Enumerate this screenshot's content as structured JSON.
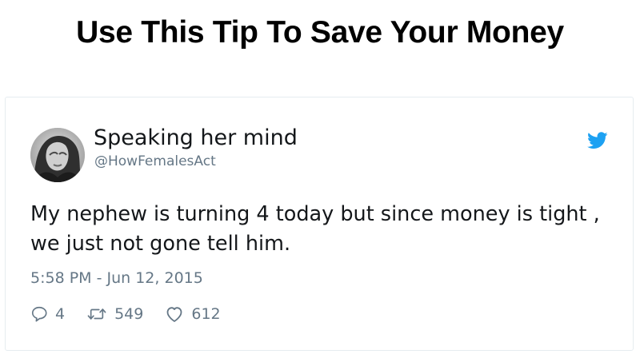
{
  "headline": "Use This Tip To Save Your Money",
  "tweet": {
    "author_name": "Speaking her mind",
    "author_handle": "@HowFemalesAct",
    "avatar_icon": "profile-photo",
    "brand_icon": "twitter-bird-icon",
    "brand_color": "#1da1f2",
    "text": "My nephew is turning 4 today but since money is tight , we just not gone tell him.",
    "timestamp": "5:58 PM - Jun 12, 2015",
    "actions": {
      "reply_count": "4",
      "retweet_count": "549",
      "like_count": "612"
    }
  }
}
